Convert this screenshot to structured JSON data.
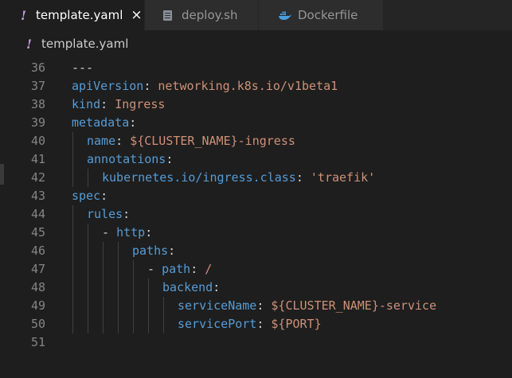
{
  "tabs": [
    {
      "label": "template.yaml",
      "icon": "yaml-icon",
      "active": true,
      "close": "×"
    },
    {
      "label": "deploy.sh",
      "icon": "shell-file-icon",
      "active": false
    },
    {
      "label": "Dockerfile",
      "icon": "docker-icon",
      "active": false
    }
  ],
  "breadcrumb": {
    "file": "template.yaml",
    "icon": "yaml-icon"
  },
  "colors": {
    "yaml_icon": "#c397d8",
    "key": "#569cd6",
    "string": "#ce9178",
    "line_number": "#858585"
  },
  "editor": {
    "lines": [
      {
        "num": "36",
        "indent": 0,
        "tokens": [
          {
            "t": "---",
            "c": "p"
          }
        ]
      },
      {
        "num": "37",
        "indent": 0,
        "tokens": [
          {
            "t": "apiVersion",
            "c": "k"
          },
          {
            "t": ": ",
            "c": "p"
          },
          {
            "t": "networking.k8s.io/v1beta1",
            "c": "s"
          }
        ]
      },
      {
        "num": "38",
        "indent": 0,
        "tokens": [
          {
            "t": "kind",
            "c": "k"
          },
          {
            "t": ": ",
            "c": "p"
          },
          {
            "t": "Ingress",
            "c": "s"
          }
        ]
      },
      {
        "num": "39",
        "indent": 0,
        "tokens": [
          {
            "t": "metadata",
            "c": "k"
          },
          {
            "t": ":",
            "c": "p"
          }
        ]
      },
      {
        "num": "40",
        "indent": 1,
        "tokens": [
          {
            "t": "name",
            "c": "k"
          },
          {
            "t": ": ",
            "c": "p"
          },
          {
            "t": "${CLUSTER_NAME}-ingress",
            "c": "s"
          }
        ]
      },
      {
        "num": "41",
        "indent": 1,
        "tokens": [
          {
            "t": "annotations",
            "c": "k"
          },
          {
            "t": ":",
            "c": "p"
          }
        ]
      },
      {
        "num": "42",
        "indent": 2,
        "tokens": [
          {
            "t": "kubernetes.io/ingress.class",
            "c": "k"
          },
          {
            "t": ": ",
            "c": "p"
          },
          {
            "t": "'traefik'",
            "c": "s"
          }
        ]
      },
      {
        "num": "43",
        "indent": 0,
        "tokens": [
          {
            "t": "spec",
            "c": "k"
          },
          {
            "t": ":",
            "c": "p"
          }
        ]
      },
      {
        "num": "44",
        "indent": 1,
        "tokens": [
          {
            "t": "rules",
            "c": "k"
          },
          {
            "t": ":",
            "c": "p"
          }
        ]
      },
      {
        "num": "45",
        "indent": 2,
        "tokens": [
          {
            "t": "- ",
            "c": "p"
          },
          {
            "t": "http",
            "c": "k"
          },
          {
            "t": ":",
            "c": "p"
          }
        ]
      },
      {
        "num": "46",
        "indent": 4,
        "tokens": [
          {
            "t": "paths",
            "c": "k"
          },
          {
            "t": ":",
            "c": "p"
          }
        ]
      },
      {
        "num": "47",
        "indent": 5,
        "tokens": [
          {
            "t": "- ",
            "c": "p"
          },
          {
            "t": "path",
            "c": "k"
          },
          {
            "t": ": ",
            "c": "p"
          },
          {
            "t": "/",
            "c": "s"
          }
        ]
      },
      {
        "num": "48",
        "indent": 6,
        "tokens": [
          {
            "t": "backend",
            "c": "k"
          },
          {
            "t": ":",
            "c": "p"
          }
        ]
      },
      {
        "num": "49",
        "indent": 7,
        "tokens": [
          {
            "t": "serviceName",
            "c": "k"
          },
          {
            "t": ": ",
            "c": "p"
          },
          {
            "t": "${CLUSTER_NAME}-service",
            "c": "s"
          }
        ]
      },
      {
        "num": "50",
        "indent": 7,
        "tokens": [
          {
            "t": "servicePort",
            "c": "k"
          },
          {
            "t": ": ",
            "c": "p"
          },
          {
            "t": "${PORT}",
            "c": "s"
          }
        ]
      },
      {
        "num": "51",
        "indent": 0,
        "tokens": []
      }
    ]
  }
}
